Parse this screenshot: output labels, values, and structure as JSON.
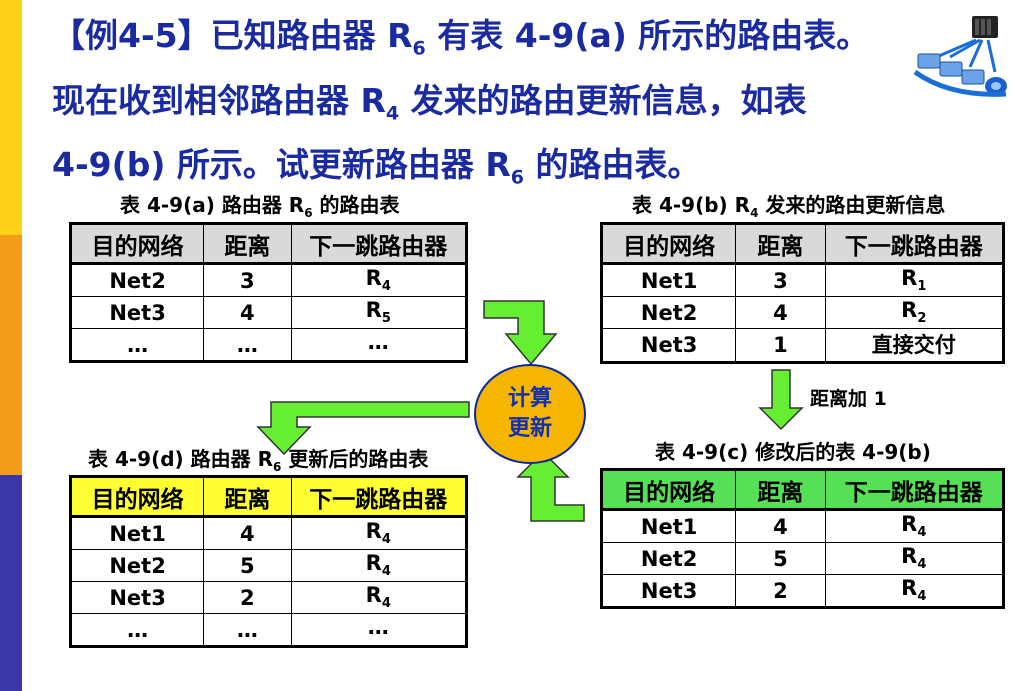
{
  "heading": {
    "l1_a": "【例4-5】已知路由器 R",
    "l1_sub": "6",
    "l1_b": " 有表 4-9(a) 所示的路由表。",
    "l2_a": "现在收到相邻路由器 R",
    "l2_sub": "4",
    "l2_b": " 发来的路由更新信息，如表",
    "l3_a": "4-9(b) 所示。试更新路由器 R",
    "l3_sub": "6",
    "l3_b": " 的路由表。"
  },
  "headers": {
    "dest": "目的网络",
    "dist": "距离",
    "next": "下一跳路由器"
  },
  "table_a": {
    "cap_a": "表 4-9(a)  路由器 R",
    "cap_sub": "6",
    "cap_b": " 的路由表",
    "rows": [
      {
        "net": "Net2",
        "dist": "3",
        "r": "R",
        "rs": "4"
      },
      {
        "net": "Net3",
        "dist": "4",
        "r": "R",
        "rs": "5"
      },
      {
        "net": "…",
        "dist": "…",
        "r": "…",
        "rs": ""
      }
    ]
  },
  "table_b": {
    "cap_a": "表 4-9(b)  R",
    "cap_sub": "4",
    "cap_b": " 发来的路由更新信息",
    "rows": [
      {
        "net": "Net1",
        "dist": "3",
        "r": "R",
        "rs": "1"
      },
      {
        "net": "Net2",
        "dist": "4",
        "r": "R",
        "rs": "2"
      },
      {
        "net": "Net3",
        "dist": "1",
        "r": "直接交付",
        "rs": ""
      }
    ]
  },
  "table_c": {
    "cap": "表 4-9(c)  修改后的表 4-9(b)",
    "rows": [
      {
        "net": "Net1",
        "dist": "4",
        "r": "R",
        "rs": "4"
      },
      {
        "net": "Net2",
        "dist": "5",
        "r": "R",
        "rs": "4"
      },
      {
        "net": "Net3",
        "dist": "2",
        "r": "R",
        "rs": "4"
      }
    ]
  },
  "table_d": {
    "cap_a": "表 4-9(d)  路由器 R",
    "cap_sub": "6",
    "cap_b": " 更新后的路由表",
    "rows": [
      {
        "net": "Net1",
        "dist": "4",
        "r": "R",
        "rs": "4"
      },
      {
        "net": "Net2",
        "dist": "5",
        "r": "R",
        "rs": "4"
      },
      {
        "net": "Net3",
        "dist": "2",
        "r": "R",
        "rs": "4"
      },
      {
        "net": "…",
        "dist": "…",
        "r": "…",
        "rs": ""
      }
    ]
  },
  "oval": {
    "line1": "计算",
    "line2": "更新"
  },
  "note": "距离加 1",
  "colors": {
    "heading": "#1a2aa0",
    "arrow": "#66ee33",
    "oval": "#f5b500",
    "yellow_header": "#ffff33",
    "green_header": "#55e055"
  }
}
